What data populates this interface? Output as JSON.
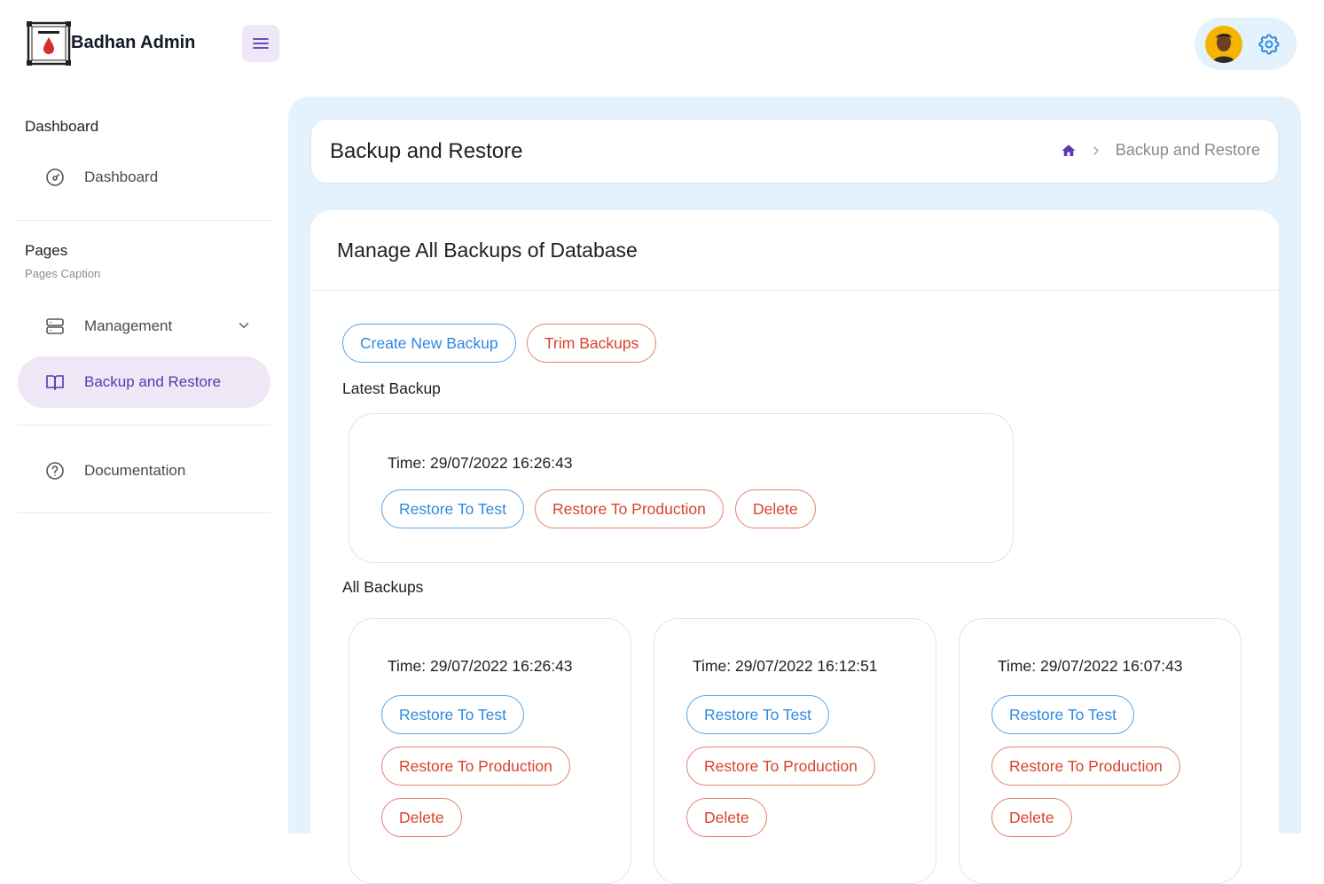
{
  "header": {
    "brand": "Badhan Admin"
  },
  "sidebar": {
    "group1": {
      "caption": "Dashboard"
    },
    "dashboard_item": {
      "label": "Dashboard"
    },
    "group2": {
      "caption": "Pages",
      "sub": "Pages Caption"
    },
    "management_item": {
      "label": "Management"
    },
    "backup_item": {
      "label": "Backup and Restore"
    },
    "documentation_item": {
      "label": "Documentation"
    }
  },
  "breadcrumb": {
    "title": "Backup and Restore",
    "current": "Backup and Restore"
  },
  "card": {
    "title": "Manage All Backups of Database",
    "create_label": "Create New Backup",
    "trim_label": "Trim Backups",
    "latest_label": "Latest Backup",
    "all_label": "All Backups"
  },
  "latest": {
    "time": "Time: 29/07/2022 16:26:43",
    "restore_test": "Restore To Test",
    "restore_prod": "Restore To Production",
    "delete": "Delete"
  },
  "backups": [
    {
      "time": "Time: 29/07/2022 16:26:43",
      "restore_test": "Restore To Test",
      "restore_prod": "Restore To Production",
      "delete": "Delete"
    },
    {
      "time": "Time: 29/07/2022 16:12:51",
      "restore_test": "Restore To Test",
      "restore_prod": "Restore To Production",
      "delete": "Delete"
    },
    {
      "time": "Time: 29/07/2022 16:07:43",
      "restore_test": "Restore To Test",
      "restore_prod": "Restore To Production",
      "delete": "Delete"
    }
  ],
  "colors": {
    "accent": "#5e35b1",
    "blue": "#2f8ae0",
    "red": "#d9432a",
    "main_bg": "#e3f2fd"
  },
  "icons": {
    "logo": "badhan-logo",
    "menu": "hamburger-menu-icon",
    "settings": "gear-icon",
    "home": "home-icon"
  }
}
